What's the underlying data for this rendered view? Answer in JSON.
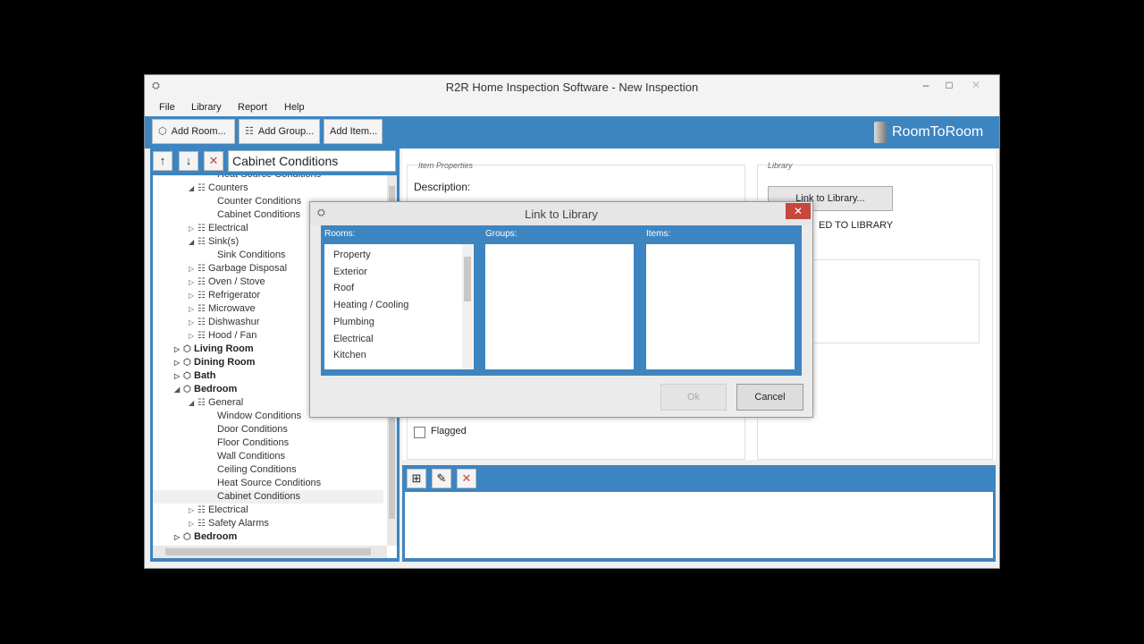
{
  "window": {
    "title": "R2R Home Inspection Software - New Inspection",
    "minimize": "–",
    "maximize": "□",
    "close": "✕"
  },
  "menu": [
    "File",
    "Library",
    "Report",
    "Help"
  ],
  "toolbar": {
    "add_room": "Add Room...",
    "add_group": "Add Group...",
    "add_item": "Add Item...",
    "brand": "RoomToRoom"
  },
  "nav": {
    "up": "↑",
    "down": "↓",
    "delete": "✕",
    "selected_name": "Cabinet Conditions"
  },
  "tree": [
    {
      "label": "Heat Source Conditions",
      "indent": 72,
      "type": "item"
    },
    {
      "label": "Counters",
      "indent": 40,
      "type": "group",
      "exp": "◢"
    },
    {
      "label": "Counter Conditions",
      "indent": 72,
      "type": "item"
    },
    {
      "label": "Cabinet Conditions",
      "indent": 72,
      "type": "item"
    },
    {
      "label": "Electrical",
      "indent": 40,
      "type": "group",
      "exp": "▷"
    },
    {
      "label": "Sink(s)",
      "indent": 40,
      "type": "group",
      "exp": "◢"
    },
    {
      "label": "Sink Conditions",
      "indent": 72,
      "type": "item"
    },
    {
      "label": "Garbage Disposal",
      "indent": 40,
      "type": "group",
      "exp": "▷"
    },
    {
      "label": "Oven / Stove",
      "indent": 40,
      "type": "group",
      "exp": "▷"
    },
    {
      "label": "Refrigerator",
      "indent": 40,
      "type": "group",
      "exp": "▷"
    },
    {
      "label": "Microwave",
      "indent": 40,
      "type": "group",
      "exp": "▷"
    },
    {
      "label": "Dishwashur",
      "indent": 40,
      "type": "group",
      "exp": "▷"
    },
    {
      "label": "Hood / Fan",
      "indent": 40,
      "type": "group",
      "exp": "▷"
    },
    {
      "label": "Living Room",
      "indent": 24,
      "type": "room",
      "exp": "▷"
    },
    {
      "label": "Dining Room",
      "indent": 24,
      "type": "room",
      "exp": "▷"
    },
    {
      "label": "Bath",
      "indent": 24,
      "type": "room",
      "exp": "▷"
    },
    {
      "label": "Bedroom",
      "indent": 24,
      "type": "room",
      "exp": "◢"
    },
    {
      "label": "General",
      "indent": 40,
      "type": "group",
      "exp": "◢"
    },
    {
      "label": "Window Conditions",
      "indent": 72,
      "type": "item"
    },
    {
      "label": "Door Conditions",
      "indent": 72,
      "type": "item"
    },
    {
      "label": "Floor Conditions",
      "indent": 72,
      "type": "item"
    },
    {
      "label": "Wall Conditions",
      "indent": 72,
      "type": "item"
    },
    {
      "label": "Ceiling Conditions",
      "indent": 72,
      "type": "item"
    },
    {
      "label": "Heat Source Conditions",
      "indent": 72,
      "type": "item"
    },
    {
      "label": "Cabinet Conditions",
      "indent": 72,
      "type": "item",
      "selected": true
    },
    {
      "label": "Electrical",
      "indent": 40,
      "type": "group",
      "exp": "▷"
    },
    {
      "label": "Safety Alarms",
      "indent": 40,
      "type": "group",
      "exp": "▷"
    },
    {
      "label": "Bedroom",
      "indent": 24,
      "type": "room",
      "exp": "▷"
    }
  ],
  "properties": {
    "item_properties_label": "Item Properties",
    "description_label": "Description:",
    "library_label": "Library",
    "link_button": "Link to Library...",
    "link_status": "ED TO LIBRARY",
    "flagged_label": "Flagged"
  },
  "bottom_tools": {
    "view": "⊞",
    "edit": "✎",
    "delete": "✕"
  },
  "dialog": {
    "title": "Link to Library",
    "close": "✕",
    "rooms_label": "Rooms:",
    "groups_label": "Groups:",
    "items_label": "Items:",
    "rooms": [
      "Property",
      "Exterior",
      "Roof",
      "Heating / Cooling",
      "Plumbing",
      "Electrical",
      "Kitchen"
    ],
    "ok": "Ok",
    "cancel": "Cancel"
  },
  "colors": {
    "accent": "#3d85c0",
    "close_red": "#c7463d"
  }
}
